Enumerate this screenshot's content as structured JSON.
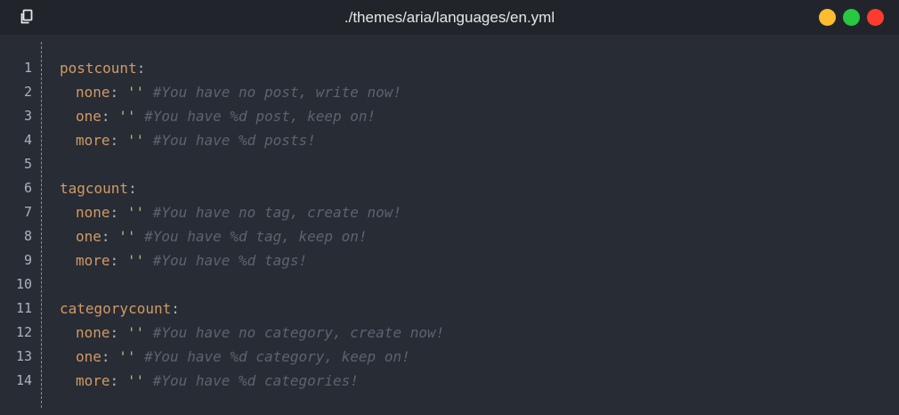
{
  "window": {
    "title": "./themes/aria/languages/en.yml",
    "controls": {
      "minimize_color": "#febc2e",
      "maximize_color": "#28c840",
      "close_color": "#ff3b30"
    }
  },
  "code": {
    "line_numbers": [
      "1",
      "2",
      "3",
      "4",
      "5",
      "6",
      "7",
      "8",
      "9",
      "10",
      "11",
      "12",
      "13",
      "14"
    ],
    "lines": [
      {
        "key": "postcount",
        "colon": ":"
      },
      {
        "key": "none",
        "colon": ":",
        "value": "''",
        "comment": "#You have no post, write now!"
      },
      {
        "key": "one",
        "colon": ":",
        "value": "''",
        "comment": "#You have %d post, keep on!"
      },
      {
        "key": "more",
        "colon": ":",
        "value": "''",
        "comment": "#You have %d posts!"
      },
      {},
      {
        "key": "tagcount",
        "colon": ":"
      },
      {
        "key": "none",
        "colon": ":",
        "value": "''",
        "comment": "#You have no tag, create now!"
      },
      {
        "key": "one",
        "colon": ":",
        "value": "''",
        "comment": "#You have %d tag, keep on!"
      },
      {
        "key": "more",
        "colon": ":",
        "value": "''",
        "comment": "#You have %d tags!"
      },
      {},
      {
        "key": "categorycount",
        "colon": ":"
      },
      {
        "key": "none",
        "colon": ":",
        "value": "''",
        "comment": "#You have no category, create now!"
      },
      {
        "key": "one",
        "colon": ":",
        "value": "''",
        "comment": "#You have %d category, keep on!"
      },
      {
        "key": "more",
        "colon": ":",
        "value": "''",
        "comment": "#You have %d categories!"
      }
    ]
  }
}
